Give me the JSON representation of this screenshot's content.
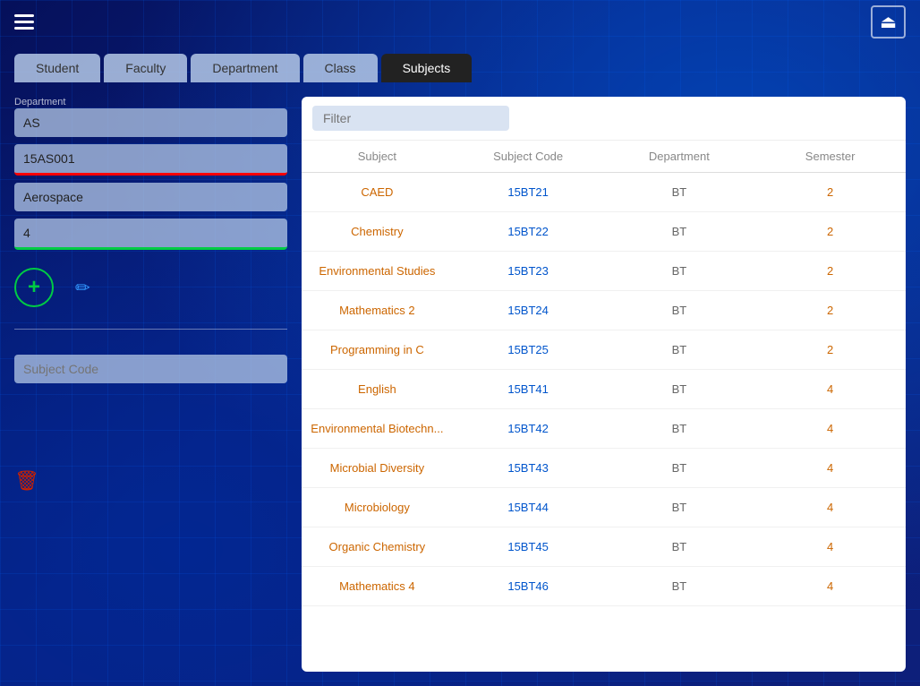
{
  "nav": {
    "tabs": [
      {
        "id": "student",
        "label": "Student",
        "active": false
      },
      {
        "id": "faculty",
        "label": "Faculty",
        "active": false
      },
      {
        "id": "department",
        "label": "Department",
        "active": false
      },
      {
        "id": "class",
        "label": "Class",
        "active": false
      },
      {
        "id": "subjects",
        "label": "Subjects",
        "active": true
      }
    ]
  },
  "left_panel": {
    "department_label": "Department",
    "department_value": "AS",
    "subject_code_field_value": "15AS001",
    "subject_name_value": "Aerospace",
    "semester_value": "4",
    "add_button_label": "+",
    "subject_code_placeholder": "Subject Code"
  },
  "filter": {
    "placeholder": "Filter",
    "value": ""
  },
  "table": {
    "headers": [
      "Subject",
      "Subject Code",
      "Department",
      "Semester"
    ],
    "rows": [
      {
        "subject": "CAED",
        "code": "15BT21",
        "dept": "BT",
        "semester": "2"
      },
      {
        "subject": "Chemistry",
        "code": "15BT22",
        "dept": "BT",
        "semester": "2"
      },
      {
        "subject": "Environmental Studies",
        "code": "15BT23",
        "dept": "BT",
        "semester": "2"
      },
      {
        "subject": "Mathematics 2",
        "code": "15BT24",
        "dept": "BT",
        "semester": "2"
      },
      {
        "subject": "Programming in C",
        "code": "15BT25",
        "dept": "BT",
        "semester": "2"
      },
      {
        "subject": "English",
        "code": "15BT41",
        "dept": "BT",
        "semester": "4"
      },
      {
        "subject": "Environmental Biotechn...",
        "code": "15BT42",
        "dept": "BT",
        "semester": "4"
      },
      {
        "subject": "Microbial Diversity",
        "code": "15BT43",
        "dept": "BT",
        "semester": "4"
      },
      {
        "subject": "Microbiology",
        "code": "15BT44",
        "dept": "BT",
        "semester": "4"
      },
      {
        "subject": "Organic Chemistry",
        "code": "15BT45",
        "dept": "BT",
        "semester": "4"
      },
      {
        "subject": "Mathematics 4",
        "code": "15BT46",
        "dept": "BT",
        "semester": "4"
      }
    ]
  },
  "icons": {
    "hamburger": "☰",
    "logout": "⏻",
    "add": "+",
    "edit": "✏",
    "delete": "🗑"
  },
  "colors": {
    "active_tab_bg": "#222222",
    "active_tab_text": "#ffffff",
    "subject_text": "#cc6600",
    "code_text": "#0055cc",
    "add_btn_color": "#00cc44",
    "edit_btn_color": "#3399ff",
    "delete_btn_color": "#cc2200"
  }
}
